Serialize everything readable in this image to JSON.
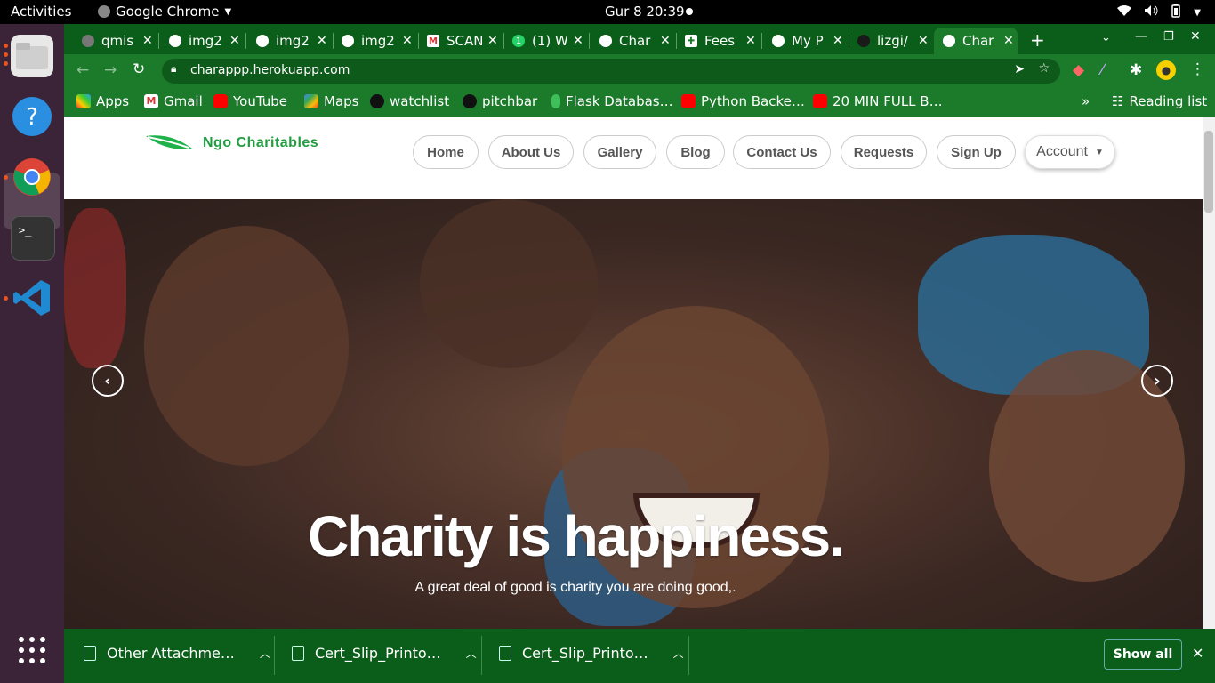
{
  "topbar": {
    "activities": "Activities",
    "app_name": "Google Chrome",
    "clock": "Gur 8  20:39"
  },
  "tabs": [
    {
      "title": "qmis"
    },
    {
      "title": "img2"
    },
    {
      "title": "img2"
    },
    {
      "title": "img2"
    },
    {
      "title": "SCAN"
    },
    {
      "title": "(1) W"
    },
    {
      "title": "Char"
    },
    {
      "title": "Fees"
    },
    {
      "title": "My P"
    },
    {
      "title": "lizgi/"
    },
    {
      "title": "Char"
    }
  ],
  "omnibox": {
    "url": "charappp.herokuapp.com"
  },
  "bookmarks": {
    "items": [
      "Apps",
      "Gmail",
      "YouTube",
      "Maps",
      "watchlist",
      "pitchbar",
      "Flask Databas…",
      "Python Backe…",
      "20 MIN FULL B…"
    ],
    "overflow": "»",
    "reading_list": "Reading list"
  },
  "site": {
    "logo_text": "Ngo Charitables",
    "nav": [
      "Home",
      "About Us",
      "Gallery",
      "Blog",
      "Contact Us",
      "Requests",
      "Sign Up"
    ],
    "account": "Account",
    "hero_title": "Charity is happiness.",
    "hero_subtitle": "A great deal of good is charity you are doing good,."
  },
  "downloads": {
    "items": [
      "Other Attachme…",
      "Cert_Slip_Printo…",
      "Cert_Slip_Printo…"
    ],
    "show_all": "Show all"
  },
  "colors": {
    "chrome_theme": "#1c7a2b",
    "tabstrip": "#0b5e1a",
    "logo_green": "#1f9d3f"
  }
}
